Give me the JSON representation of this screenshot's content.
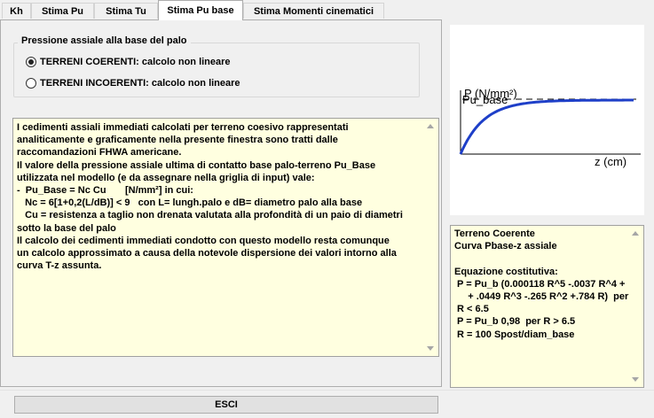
{
  "tabs": [
    {
      "label": "Kh"
    },
    {
      "label": "Stima Pu"
    },
    {
      "label": "Stima Tu"
    },
    {
      "label": "Stima Pu base"
    },
    {
      "label": "Stima Momenti cinematici"
    }
  ],
  "active_tab": "Stima Pu base",
  "pressure_group": {
    "title": "Pressione assiale alla base del  palo",
    "options": [
      {
        "label": "TERRENI COERENTI:  calcolo non lineare",
        "checked": true
      },
      {
        "label": "TERRENI INCOERENTI:  calcolo non lineare",
        "checked": false
      }
    ]
  },
  "description": {
    "lines": [
      "I cedimenti assiali immediati calcolati per terreno coesivo rappresentati",
      "analiticamente e graficamente nella presente finestra sono tratti dalle",
      "raccomandazioni FHWA americane.",
      "Il valore della pressione assiale ultima di contatto base palo-terreno Pu_Base",
      "utilizzata nel modello (e da assegnare nella griglia di input) vale:",
      "-  Pu_Base = Nc Cu       [N/mm²] in cui:",
      "   Nc = 6[1+0,2(L/dB)] < 9   con L= lungh.palo e dB= diametro palo alla base",
      "   Cu = resistenza a taglio non drenata valutata alla profondità di un paio di diametri",
      "sotto la base del palo",
      "Il calcolo dei cedimenti immediati condotto con questo modello resta comunque",
      "un calcolo approssimato a causa della notevole dispersione dei valori intorno alla",
      "curva T-z assunta."
    ]
  },
  "chart": {
    "y_axis_label": "P (N/mm²)",
    "curve_label": "Pu_base",
    "x_axis_label": "z (cm)",
    "curve_color": "#1e3fc8"
  },
  "info_panel": {
    "lines": [
      "Terreno Coerente",
      "Curva Pbase-z assiale",
      "",
      "Equazione costitutiva:",
      " P = Pu_b (0.000118 R^5 -.0037 R^4 +",
      "     + .0449 R^3 -.265 R^2 +.784 R)  per",
      " R < 6.5",
      " P = Pu_b 0,98  per R > 6.5",
      " R = 100 Spost/diam_base"
    ]
  },
  "exit_button": {
    "label": "ESCI"
  }
}
